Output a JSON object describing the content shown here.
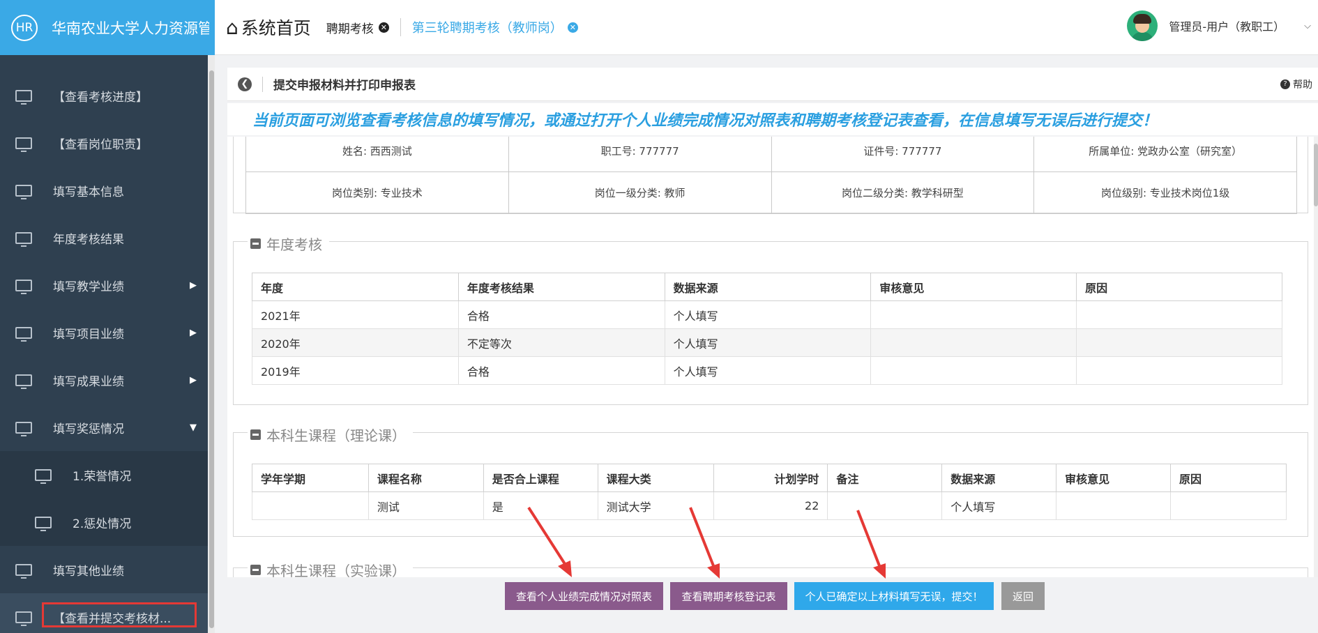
{
  "header": {
    "logo_badge": "HR",
    "app_title": "华南农业大学人力资源管",
    "home_label": "系统首页",
    "tabs": [
      {
        "label": "聘期考核"
      },
      {
        "label": "第三轮聘期考核（教师岗）"
      }
    ],
    "user_name": "管理员-用户（教职工）"
  },
  "sidebar": {
    "items": [
      {
        "label": "【查看考核进度】"
      },
      {
        "label": "【查看岗位职责】"
      },
      {
        "label": "填写基本信息"
      },
      {
        "label": "年度考核结果"
      },
      {
        "label": "填写教学业绩"
      },
      {
        "label": "填写项目业绩"
      },
      {
        "label": "填写成果业绩"
      },
      {
        "label": "填写奖惩情况"
      },
      {
        "label": "1.荣誉情况"
      },
      {
        "label": "2.惩处情况"
      },
      {
        "label": "填写其他业绩"
      },
      {
        "label": "【查看并提交考核材..."
      }
    ]
  },
  "page": {
    "title": "提交申报材料并打印申报表",
    "help_label": "帮助",
    "notice": "当前页面可浏览查看考核信息的填写情况，或通过打开个人业绩完成情况对照表和聘期考核登记表查看，在信息填写无误后进行提交！"
  },
  "info": {
    "row1": [
      "姓名: 西西测试",
      "职工号: 777777",
      "证件号: 777777",
      "所属单位: 党政办公室（研究室）"
    ],
    "row2": [
      "岗位类别: 专业技术",
      "岗位一级分类: 教师",
      "岗位二级分类: 教学科研型",
      "岗位级别: 专业技术岗位1级"
    ]
  },
  "annual": {
    "legend": "年度考核",
    "headers": [
      "年度",
      "年度考核结果",
      "数据来源",
      "审核意见",
      "原因"
    ],
    "rows": [
      [
        "2021年",
        "合格",
        "个人填写",
        "",
        ""
      ],
      [
        "2020年",
        "不定等次",
        "个人填写",
        "",
        ""
      ],
      [
        "2019年",
        "合格",
        "个人填写",
        "",
        ""
      ]
    ]
  },
  "theory": {
    "legend": "本科生课程（理论课）",
    "headers": [
      "学年学期",
      "课程名称",
      "是否合上课程",
      "课程大类",
      "计划学时",
      "备注",
      "数据来源",
      "审核意见",
      "原因"
    ],
    "rows": [
      [
        "",
        "测试",
        "是",
        "测试大学",
        "22",
        "",
        "个人填写",
        "",
        ""
      ]
    ]
  },
  "lab": {
    "legend": "本科生课程（实验课）"
  },
  "buttons": {
    "compare": "查看个人业绩完成情况对照表",
    "register": "查看聘期考核登记表",
    "submit": "个人已确定以上材料填写无误，提交！",
    "back": "返回"
  },
  "colors": {
    "accent": "#3aa9e6",
    "sidebar_bg": "#2f4050",
    "purple_button": "#8a5a8c",
    "blue_button": "#2fa8ea",
    "annotation_red": "#e53935"
  }
}
